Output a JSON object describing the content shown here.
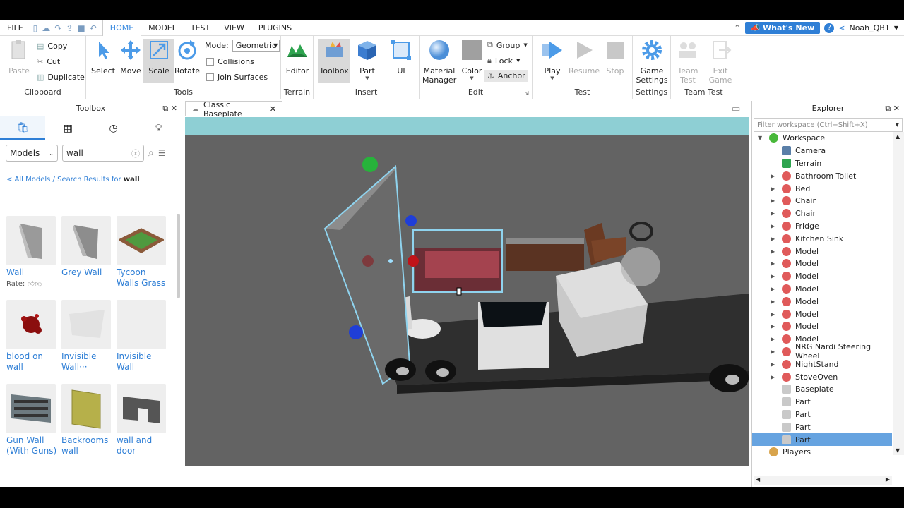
{
  "menubar": {
    "items": [
      "FILE",
      "HOME",
      "MODEL",
      "TEST",
      "VIEW",
      "PLUGINS"
    ],
    "active": "HOME",
    "whats_new": "What's New",
    "username": "Noah_QB1"
  },
  "ribbon": {
    "clipboard": {
      "paste": "Paste",
      "copy": "Copy",
      "cut": "Cut",
      "duplicate": "Duplicate",
      "label": "Clipboard"
    },
    "tools": {
      "select": "Select",
      "move": "Move",
      "scale": "Scale",
      "rotate": "Rotate",
      "mode_label": "Mode:",
      "mode_value": "Geometric",
      "collisions": "Collisions",
      "join_surfaces": "Join Surfaces",
      "label": "Tools"
    },
    "terrain": {
      "editor": "Editor",
      "label": "Terrain"
    },
    "insert": {
      "toolbox": "Toolbox",
      "part": "Part",
      "ui": "UI",
      "label": "Insert"
    },
    "edit": {
      "material_manager_1": "Material",
      "material_manager_2": "Manager",
      "color": "Color",
      "group": "Group",
      "lock": "Lock",
      "anchor": "Anchor",
      "label": "Edit"
    },
    "test": {
      "play": "Play",
      "resume": "Resume",
      "stop": "Stop",
      "label": "Test"
    },
    "settings": {
      "game_settings_1": "Game",
      "game_settings_2": "Settings",
      "label": "Settings"
    },
    "team_test": {
      "team_test_1": "Team",
      "team_test_2": "Test",
      "exit_game_1": "Exit",
      "exit_game_2": "Game",
      "label": "Team Test"
    }
  },
  "toolbox": {
    "title": "Toolbox",
    "category": "Models",
    "search_value": "wall",
    "breadcrumb_prefix": "< All Models / Search Results for ",
    "breadcrumb_term": "wall",
    "rate_label": "Rate:",
    "items": [
      {
        "label": "Wall"
      },
      {
        "label": "Grey Wall"
      },
      {
        "label": "Tycoon Walls Grass"
      },
      {
        "label": "blood on wall"
      },
      {
        "label": "Invisible Wall···"
      },
      {
        "label": "Invisible Wall"
      },
      {
        "label": "Gun Wall (With Guns)"
      },
      {
        "label": "Backrooms wall"
      },
      {
        "label": "wall and door"
      }
    ]
  },
  "doc_tab": {
    "title": "Classic Baseplate"
  },
  "explorer": {
    "title": "Explorer",
    "filter_placeholder": "Filter workspace (Ctrl+Shift+X)",
    "tree": [
      {
        "label": "Workspace",
        "level": 0,
        "icon": "workspace",
        "expanded": true
      },
      {
        "label": "Camera",
        "level": 1,
        "icon": "camera"
      },
      {
        "label": "Terrain",
        "level": 1,
        "icon": "terrain"
      },
      {
        "label": "Bathroom Toilet",
        "level": 1,
        "icon": "model",
        "arrow": true
      },
      {
        "label": "Bed",
        "level": 1,
        "icon": "model",
        "arrow": true
      },
      {
        "label": "Chair",
        "level": 1,
        "icon": "model",
        "arrow": true
      },
      {
        "label": "Chair",
        "level": 1,
        "icon": "model",
        "arrow": true
      },
      {
        "label": "Fridge",
        "level": 1,
        "icon": "model",
        "arrow": true
      },
      {
        "label": "Kitchen Sink",
        "level": 1,
        "icon": "model",
        "arrow": true
      },
      {
        "label": "Model",
        "level": 1,
        "icon": "model",
        "arrow": true
      },
      {
        "label": "Model",
        "level": 1,
        "icon": "model",
        "arrow": true
      },
      {
        "label": "Model",
        "level": 1,
        "icon": "model",
        "arrow": true
      },
      {
        "label": "Model",
        "level": 1,
        "icon": "model",
        "arrow": true
      },
      {
        "label": "Model",
        "level": 1,
        "icon": "model",
        "arrow": true
      },
      {
        "label": "Model",
        "level": 1,
        "icon": "model",
        "arrow": true
      },
      {
        "label": "Model",
        "level": 1,
        "icon": "model",
        "arrow": true
      },
      {
        "label": "Model",
        "level": 1,
        "icon": "model",
        "arrow": true
      },
      {
        "label": "NRG Nardi Steering Wheel",
        "level": 1,
        "icon": "model",
        "arrow": true
      },
      {
        "label": "NightStand",
        "level": 1,
        "icon": "model",
        "arrow": true
      },
      {
        "label": "StoveOven",
        "level": 1,
        "icon": "model",
        "arrow": true
      },
      {
        "label": "Baseplate",
        "level": 1,
        "icon": "part"
      },
      {
        "label": "Part",
        "level": 1,
        "icon": "part"
      },
      {
        "label": "Part",
        "level": 1,
        "icon": "part"
      },
      {
        "label": "Part",
        "level": 1,
        "icon": "part"
      },
      {
        "label": "Part",
        "level": 1,
        "icon": "part",
        "selected": true
      },
      {
        "label": "Players",
        "level": 0,
        "icon": "players"
      }
    ]
  },
  "colors": {
    "accent": "#2f7fd6",
    "selected_row": "#66a3e0",
    "sky": "#8ecfd4",
    "baseplate": "#616161"
  }
}
